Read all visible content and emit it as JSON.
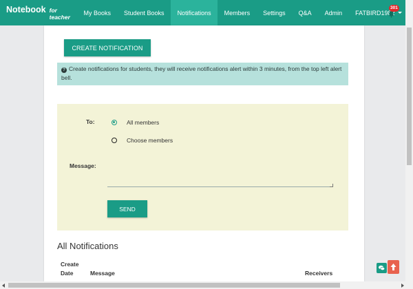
{
  "navbar": {
    "brand": "Notebook",
    "brand_sub": "for teacher",
    "items": [
      {
        "label": "My Books"
      },
      {
        "label": "Student Books"
      },
      {
        "label": "Notifications",
        "active": true
      },
      {
        "label": "Members"
      },
      {
        "label": "Settings"
      },
      {
        "label": "Q&A"
      },
      {
        "label": "Admin"
      }
    ],
    "user": "FATBIRD1982",
    "notification_count": "301",
    "icons": {
      "bell": "bell-icon",
      "caret": "chevron-down-icon"
    }
  },
  "toolbar": {
    "create_label": "CREATE NOTIFICATION"
  },
  "info": {
    "icon": "question-circle-icon",
    "text": "Create notifications for students, they will receive notifications alert within 3 minutes, from the top left alert bell."
  },
  "form": {
    "to_label": "To:",
    "options": [
      {
        "label": "All members",
        "selected": true
      },
      {
        "label": "Choose members",
        "selected": false
      }
    ],
    "message_label": "Message:",
    "message_value": "",
    "send_label": "SEND"
  },
  "all_notifications": {
    "title": "All Notifications",
    "columns": [
      "Create Date",
      "Message",
      "Receivers"
    ]
  },
  "colors": {
    "accent": "#1a9c86",
    "info_bg": "#b6e1dc",
    "form_bg": "#f3f3d7",
    "badge": "#e0292b"
  },
  "floating": {
    "chat_icon": "chat-icon",
    "up_icon": "arrow-up-icon"
  }
}
